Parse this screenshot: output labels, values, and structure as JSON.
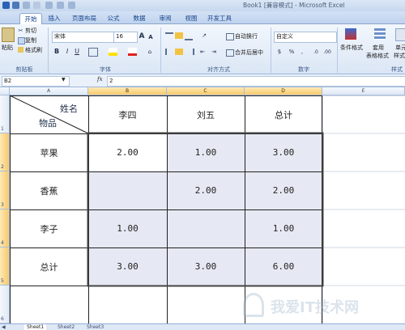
{
  "window": {
    "title": "Book1 [兼容模式] - Microsoft Excel"
  },
  "tabs": [
    "开始",
    "插入",
    "页面布局",
    "公式",
    "数据",
    "审阅",
    "视图",
    "开发工具"
  ],
  "ribbon": {
    "clipboard": {
      "paste": "粘贴",
      "cut": "剪切",
      "copy": "复制",
      "format_painter": "格式刷",
      "label": "剪贴板"
    },
    "font": {
      "family": "宋体",
      "size": "16",
      "grow": "A",
      "shrink": "A",
      "bold": "B",
      "italic": "I",
      "underline": "U",
      "label": "字体"
    },
    "alignment": {
      "wrap": "自动换行",
      "merge": "合并后居中",
      "label": "对齐方式"
    },
    "number": {
      "format": "自定义",
      "percent": "%",
      "comma": ",",
      "label": "数字"
    },
    "styles": {
      "conditional": "条件格式",
      "table_format_1": "套用",
      "table_format_2": "表格格式",
      "cell_styles_1": "单元",
      "cell_styles_2": "样式",
      "label": "样式"
    }
  },
  "formula_bar": {
    "name_box": "B2",
    "fx": "fx",
    "value": "2"
  },
  "columns": [
    "A",
    "B",
    "C",
    "D",
    "E"
  ],
  "rows": [
    "1",
    "2",
    "3",
    "4",
    "5",
    "6"
  ],
  "table": {
    "corner_top": "姓名",
    "corner_bottom": "物品",
    "headers": [
      "李四",
      "刘五",
      "总计"
    ],
    "rows": [
      {
        "label": "苹果",
        "values": [
          "2.00",
          "1.00",
          "3.00"
        ]
      },
      {
        "label": "香蕉",
        "values": [
          "",
          "2.00",
          "2.00"
        ]
      },
      {
        "label": "李子",
        "values": [
          "1.00",
          "",
          "1.00"
        ]
      },
      {
        "label": "总计",
        "values": [
          "3.00",
          "3.00",
          "6.00"
        ]
      }
    ]
  },
  "sheet_tabs": [
    "Sheet1",
    "Sheet2",
    "Sheet3"
  ],
  "watermark": "我爱IT技术网"
}
